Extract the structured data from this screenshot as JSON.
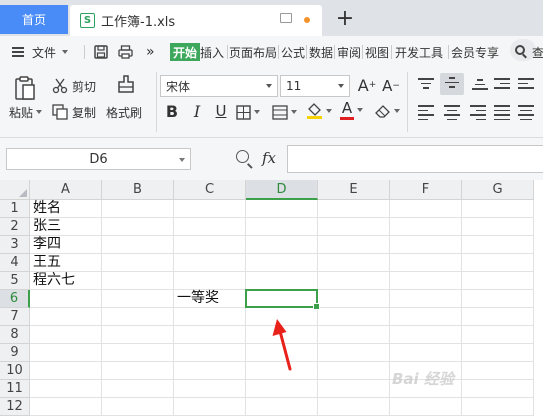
{
  "tabs": {
    "home": "首页",
    "document": "工作簿-1.xls",
    "doc_icon": "S",
    "new_tab": "+"
  },
  "menu": {
    "file": "文件",
    "more": "»",
    "items": [
      "开始",
      "插入",
      "页面布局",
      "公式",
      "数据",
      "审阅",
      "视图",
      "开发工具",
      "会员专享"
    ],
    "search_partial": "查"
  },
  "ribbon": {
    "paste": "粘贴",
    "cut": "剪切",
    "copy": "复制",
    "format_painter": "格式刷",
    "font_name": "宋体",
    "font_size": "11",
    "bold": "B",
    "italic": "I",
    "underline": "U",
    "font_color_letter": "A",
    "grow_font": "A",
    "shrink_font": "A",
    "accent_green": "#3da85c",
    "font_color": "#e02020",
    "fill_color": "#f6d200"
  },
  "formula_bar": {
    "name_box": "D6",
    "fx": "fx",
    "content": ""
  },
  "sheet": {
    "columns": [
      "A",
      "B",
      "C",
      "D",
      "E",
      "F",
      "G"
    ],
    "rows": [
      "1",
      "2",
      "3",
      "4",
      "5",
      "6",
      "7",
      "8",
      "9",
      "10",
      "11",
      "12"
    ],
    "selected_cell": "D6",
    "cells": {
      "A1": "姓名",
      "A2": "张三",
      "A3": "李四",
      "A4": "王五",
      "A5": "程六七",
      "C6": "一等奖"
    }
  },
  "watermark": "Bai 经验"
}
